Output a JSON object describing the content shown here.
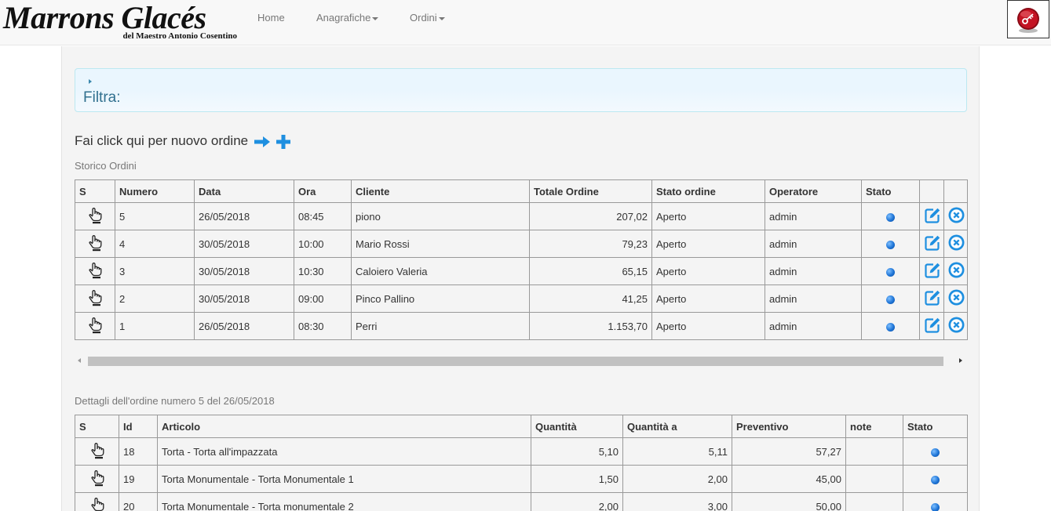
{
  "brand": {
    "title": "Marrons Glacés",
    "subtitle": "del Maestro Antonio Cosentino"
  },
  "nav": {
    "home": "Home",
    "anagrafiche": "Anagrafiche",
    "ordini": "Ordini"
  },
  "filter": {
    "title": "Filtra:"
  },
  "new_order": {
    "label": "Fai click qui per nuovo ordine"
  },
  "orders": {
    "section_label": "Storico Ordini",
    "columns": [
      "S",
      "Numero",
      "Data",
      "Ora",
      "Cliente",
      "Totale Ordine",
      "Stato ordine",
      "Operatore",
      "Stato",
      "",
      ""
    ],
    "rows": [
      {
        "numero": "5",
        "data": "26/05/2018",
        "ora": "08:45",
        "cliente": "piono",
        "totale": "207,02",
        "stato_ordine": "Aperto",
        "operatore": "admin"
      },
      {
        "numero": "4",
        "data": "30/05/2018",
        "ora": "10:00",
        "cliente": "Mario Rossi",
        "totale": "79,23",
        "stato_ordine": "Aperto",
        "operatore": "admin"
      },
      {
        "numero": "3",
        "data": "30/05/2018",
        "ora": "10:30",
        "cliente": "Caloiero Valeria",
        "totale": "65,15",
        "stato_ordine": "Aperto",
        "operatore": "admin"
      },
      {
        "numero": "2",
        "data": "30/05/2018",
        "ora": "09:00",
        "cliente": "Pinco Pallino",
        "totale": "41,25",
        "stato_ordine": "Aperto",
        "operatore": "admin"
      },
      {
        "numero": "1",
        "data": "26/05/2018",
        "ora": "08:30",
        "cliente": "Perri",
        "totale": "1.153,70",
        "stato_ordine": "Aperto",
        "operatore": "admin"
      }
    ]
  },
  "details": {
    "section_label": "Dettagli dell'ordine numero 5 del 26/05/2018",
    "columns": [
      "S",
      "Id",
      "Articolo",
      "Quantità",
      "Quantità a",
      "Preventivo",
      "note",
      "Stato"
    ],
    "rows": [
      {
        "id": "18",
        "articolo": "Torta - Torta all'impazzata",
        "quantita": "5,10",
        "quantita_a": "5,11",
        "preventivo": "57,27",
        "note": ""
      },
      {
        "id": "19",
        "articolo": "Torta Monumentale - Torta Monumentale 1",
        "quantita": "1,50",
        "quantita_a": "2,00",
        "preventivo": "45,00",
        "note": ""
      },
      {
        "id": "20",
        "articolo": "Torta Monumentale - Torta monumentale 2",
        "quantita": "2,00",
        "quantita_a": "3,00",
        "preventivo": "50,00",
        "note": ""
      }
    ]
  },
  "icons": {
    "select": "pointing-hand-icon",
    "status": "blue-dot-icon",
    "edit": "edit-icon",
    "delete": "delete-icon",
    "new_arrow": "arrow-right-icon",
    "new_plus": "plus-icon",
    "login": "key-icon"
  },
  "colors": {
    "accent": "#1e8fe0",
    "status_dot": "#1e74d6",
    "login_red": "#b01020"
  }
}
